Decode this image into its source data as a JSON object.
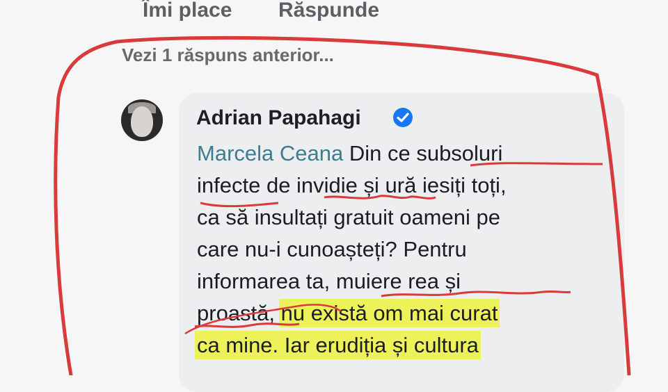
{
  "actions": {
    "like_label": "Îmi place",
    "reply_label": "Răspunde"
  },
  "thread": {
    "previous_replies_label": "Vezi 1 răspuns anterior..."
  },
  "comment": {
    "author": "Adrian Papahagi",
    "verified": true,
    "avatar_icon": "profile-photo",
    "mention": "Marcela Ceana",
    "lines": [
      "Din ce subsoluri",
      "infecte de invidie și ură iesiți toți,",
      "ca să insultați gratuit oameni pe",
      "care nu-i cunoașteți? Pentru",
      "informarea ta, muiere rea și",
      "proastă, ",
      "nu există om mai curat",
      "ca mine. Iar erudiția și cultura"
    ]
  },
  "colors": {
    "annotation_red": "#d93a3a",
    "highlight_yellow": "#eef25a",
    "verified_blue": "#1877f2",
    "mention_teal": "#3e7d8f"
  }
}
